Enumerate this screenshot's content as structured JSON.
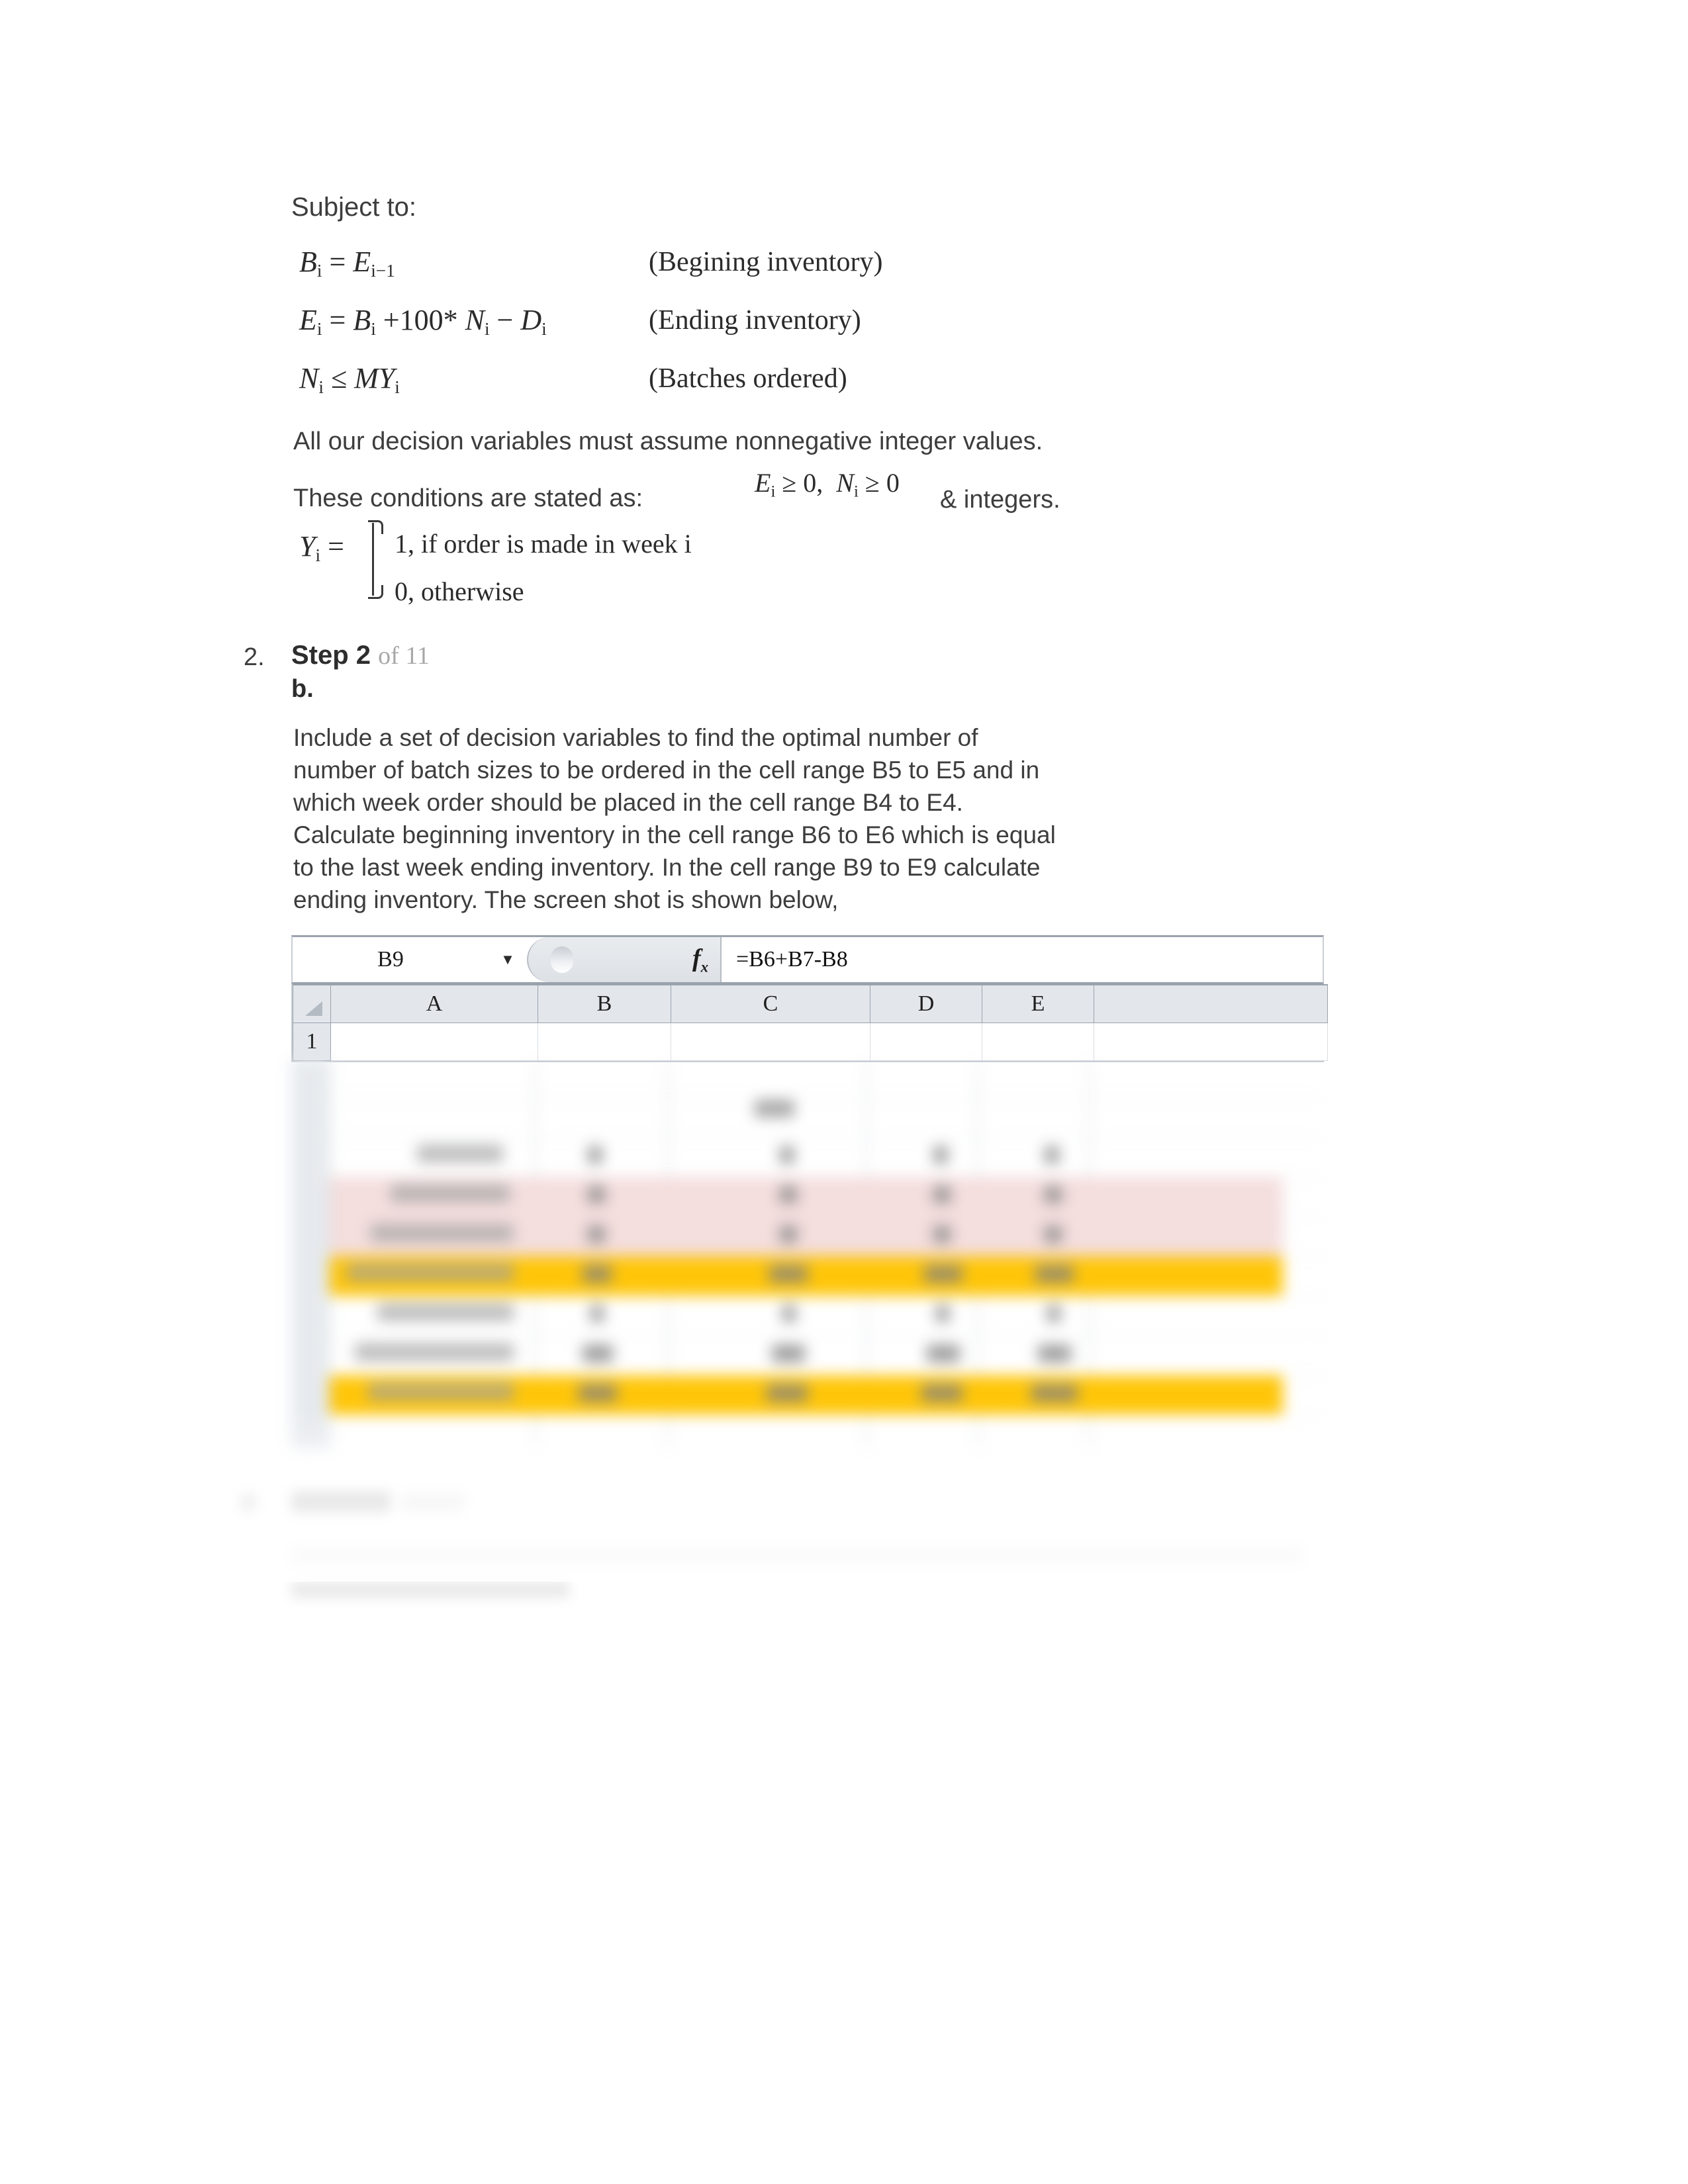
{
  "document": {
    "subject_to_label": "Subject to:",
    "equations": [
      {
        "lhs_html": "B<sub>i</sub> = E<sub>i−1</sub>",
        "label": "(Begining inventory)"
      },
      {
        "lhs_html": "E<sub>i</sub> = B<sub>i</sub> + 100*N<sub>i</sub> − D<sub>i</sub>",
        "label": "(Ending inventory)"
      },
      {
        "lhs_html": "N<sub>i</sub> ≤ MY<sub>i</sub>",
        "label": "(Batches ordered)"
      }
    ],
    "nonnegative_sentence": "All our decision variables must assume nonnegative integer values.",
    "conditions_prefix": "These conditions are stated as:",
    "conditions_math": "Eᵢ ≥ 0,  Nᵢ ≥ 0",
    "conditions_suffix": "& integers.",
    "binary_def": {
      "lhs": "Y",
      "lhs_sub": "i",
      "equals": "=",
      "case_one": "1,  if order is made in week i",
      "case_zero": "0,  otherwise"
    }
  },
  "step2": {
    "list_number": "2.",
    "title": "Step 2",
    "of_label": "of 11",
    "sub_letter": "b.",
    "body": "Include a set of decision variables to find the optimal number of number of batch sizes to be ordered in the cell range B5 to E5 and in which week order should be placed in the cell range B4 to E4. Calculate beginning inventory in the cell range B6 to E6 which is equal to the last week ending inventory. In the cell range B9 to E9 calculate ending inventory. The screen shot is shown below,"
  },
  "excel": {
    "name_box_value": "B9",
    "fx_label": "fx",
    "formula_value": "=B6+B7-B8",
    "column_headers": [
      "A",
      "B",
      "C",
      "D",
      "E"
    ],
    "visible_row_numbers": [
      "1"
    ],
    "highlight_colors": {
      "pink_rows": "#F4DDDD",
      "yellow_rows": "#FFC400"
    },
    "blurred_row_labels": [
      "Week",
      "Place Order",
      "Batches Ordered",
      "Beginning Inventory",
      "Amount Ordered",
      "Amount Demanded",
      "Ending Inventory"
    ]
  },
  "step3": {
    "list_number": "3.",
    "title": "Step 3",
    "of_label": "of 11",
    "body": "In the cell range B12 to E12 find the linking constraint. The screen shot is shown below,"
  }
}
